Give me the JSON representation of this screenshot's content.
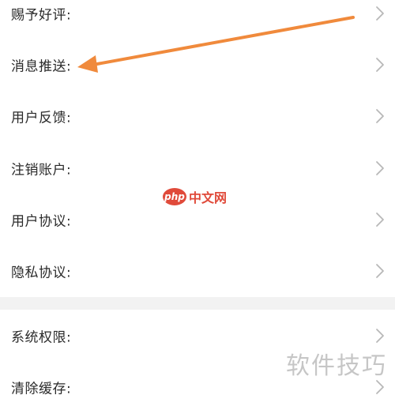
{
  "settings": {
    "group1": [
      {
        "label": "赐予好评:"
      },
      {
        "label": "消息推送:"
      },
      {
        "label": "用户反馈:"
      },
      {
        "label": "注销账户:"
      },
      {
        "label": "用户协议:"
      },
      {
        "label": "隐私协议:"
      }
    ],
    "group2": [
      {
        "label": "系统权限:"
      },
      {
        "label": "清除缓存:"
      }
    ]
  },
  "annotation": {
    "arrow_color": "#f08a3c"
  },
  "watermarks": {
    "center_logo": "php",
    "center_text": "中文网",
    "corner_text": "软件技巧"
  },
  "colors": {
    "background": "#f2f2f2",
    "row_background": "#ffffff",
    "text": "#2a2a2a",
    "chevron": "#b8b8b8",
    "accent_red": "#e04a3a"
  },
  "icons": {
    "chevron": "chevron-right-icon"
  }
}
